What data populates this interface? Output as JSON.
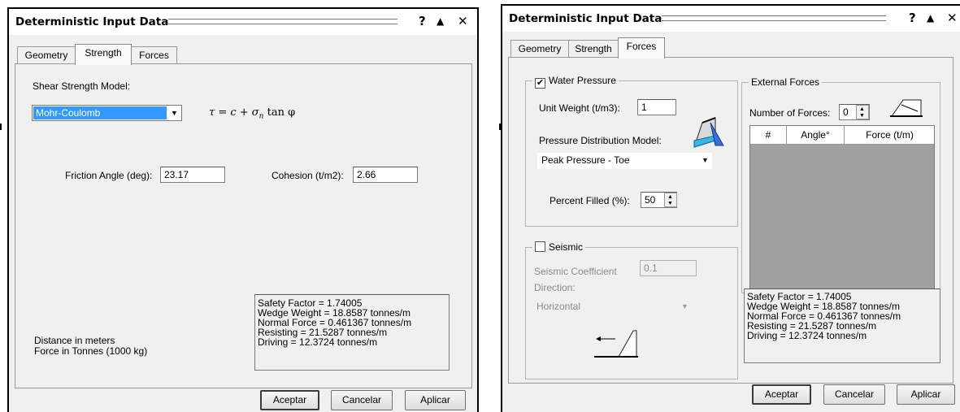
{
  "left_dialog": {
    "title": "Deterministic Input Data",
    "help_button": "?",
    "minimize_button": "▲",
    "close_button": "✕",
    "tabs": [
      {
        "label": "Geometry",
        "active": false
      },
      {
        "label": "Strength",
        "active": true
      },
      {
        "label": "Forces",
        "active": false
      }
    ],
    "strength": {
      "model_label": "Shear Strength Model:",
      "model_value": "Mohr-Coulomb",
      "formula": "τ = c + σ",
      "formula_sub": "n",
      "formula_tail": " tan φ",
      "friction_label": "Friction Angle (deg):",
      "friction_value": "23.17",
      "cohesion_label": "Cohesion (t/m2):",
      "cohesion_value": "2.66"
    },
    "units": [
      "Distance in meters",
      "Force in Tonnes (1000 kg)"
    ],
    "results": [
      "Safety Factor = 1.74005",
      "Wedge Weight = 18.8587 tonnes/m",
      "Normal Force = 0.461367 tonnes/m",
      "Resisting = 21.5287 tonnes/m",
      "Driving = 12.3724 tonnes/m"
    ],
    "buttons": {
      "ok": "Aceptar",
      "cancel": "Cancelar",
      "apply": "Aplicar"
    }
  },
  "right_dialog": {
    "title": "Deterministic Input Data",
    "help_button": "?",
    "minimize_button": "▲",
    "close_button": "✕",
    "tabs": [
      {
        "label": "Geometry",
        "active": false
      },
      {
        "label": "Strength",
        "active": false
      },
      {
        "label": "Forces",
        "active": true
      }
    ],
    "water": {
      "group_label": "Water Pressure",
      "checked": true,
      "check_mark": "✔",
      "unit_weight_label": "Unit Weight (t/m3):",
      "unit_weight_value": "1",
      "distribution_label": "Pressure Distribution Model:",
      "distribution_value": "Peak Pressure - Toe",
      "percent_label": "Percent Filled (%):",
      "percent_value": "50"
    },
    "seismic": {
      "group_label": "Seismic",
      "checked": false,
      "coefficient_label": "Seismic Coefficient",
      "coefficient_value": "0.1",
      "direction_label": "Direction:",
      "direction_value": "Horizontal"
    },
    "external": {
      "group_label": "External Forces",
      "count_label": "Number of Forces:",
      "count_value": "0",
      "columns": [
        "#",
        "Angle°",
        "Force (t/m)"
      ]
    },
    "results": [
      "Safety Factor = 1.74005",
      "Wedge Weight = 18.8587 tonnes/m",
      "Normal Force = 0.461367 tonnes/m",
      "Resisting = 21.5287 tonnes/m",
      "Driving = 12.3724 tonnes/m"
    ],
    "buttons": {
      "ok": "Aceptar",
      "cancel": "Cancelar",
      "apply": "Aplicar"
    }
  }
}
